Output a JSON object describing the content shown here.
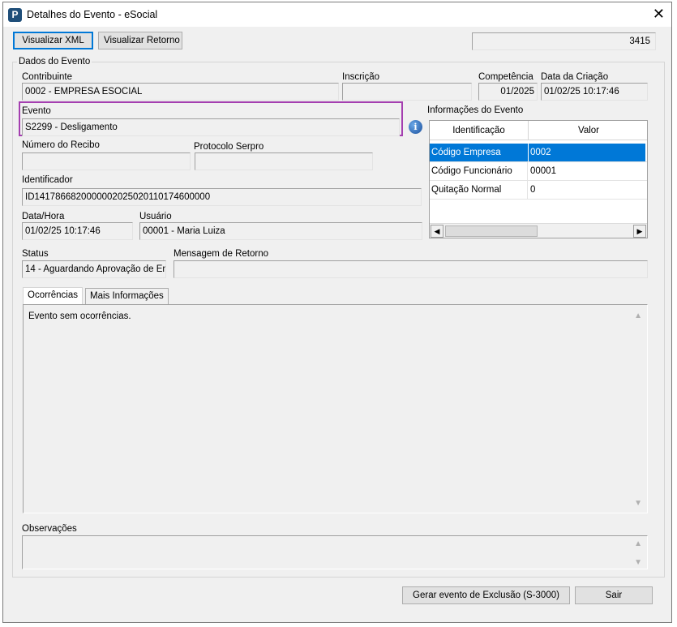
{
  "window": {
    "title": "Detalhes do Evento - eSocial",
    "app_icon_letter": "P"
  },
  "toolbar": {
    "view_xml_label": "Visualizar XML",
    "view_return_label": "Visualizar Retorno",
    "event_number": "3415"
  },
  "dados": {
    "group_title": "Dados do Evento",
    "contribuinte_label": "Contribuinte",
    "contribuinte_value": "0002 - EMPRESA ESOCIAL",
    "inscricao_label": "Inscrição",
    "inscricao_value": "",
    "competencia_label": "Competência",
    "competencia_value": "01/2025",
    "data_criacao_label": "Data da Criação",
    "data_criacao_value": "01/02/25 10:17:46",
    "evento_label": "Evento",
    "evento_value": "S2299 - Desligamento",
    "numero_recibo_label": "Número do Recibo",
    "numero_recibo_value": "",
    "protocolo_label": "Protocolo Serpro",
    "protocolo_value": "",
    "identificador_label": "Identificador",
    "identificador_value": "ID1417866820000002025020110174600000",
    "data_hora_label": "Data/Hora",
    "data_hora_value": "01/02/25 10:17:46",
    "usuario_label": "Usuário",
    "usuario_value": "00001 - Maria Luiza",
    "status_label": "Status",
    "status_value": "14 - Aguardando Aprovação de En",
    "mensagem_label": "Mensagem de Retorno",
    "mensagem_value": ""
  },
  "info_evento": {
    "title": "Informações do Evento",
    "columns": [
      "Identificação",
      "Valor"
    ],
    "rows": [
      {
        "id": "Código Empresa",
        "valor": "0002"
      },
      {
        "id": "Código Funcionário",
        "valor": "00001"
      },
      {
        "id": "Quitação Normal",
        "valor": "0"
      }
    ]
  },
  "tabs": {
    "ocorrencias_label": "Ocorrências",
    "mais_info_label": "Mais Informações",
    "ocorrencias_text": "Evento sem ocorrências."
  },
  "observacoes": {
    "label": "Observações",
    "value": ""
  },
  "footer": {
    "gerar_exclusao_label": "Gerar evento de Exclusão (S-3000)",
    "sair_label": "Sair"
  },
  "colors": {
    "selection": "#0078d7",
    "highlight_border": "#a43fb0"
  }
}
